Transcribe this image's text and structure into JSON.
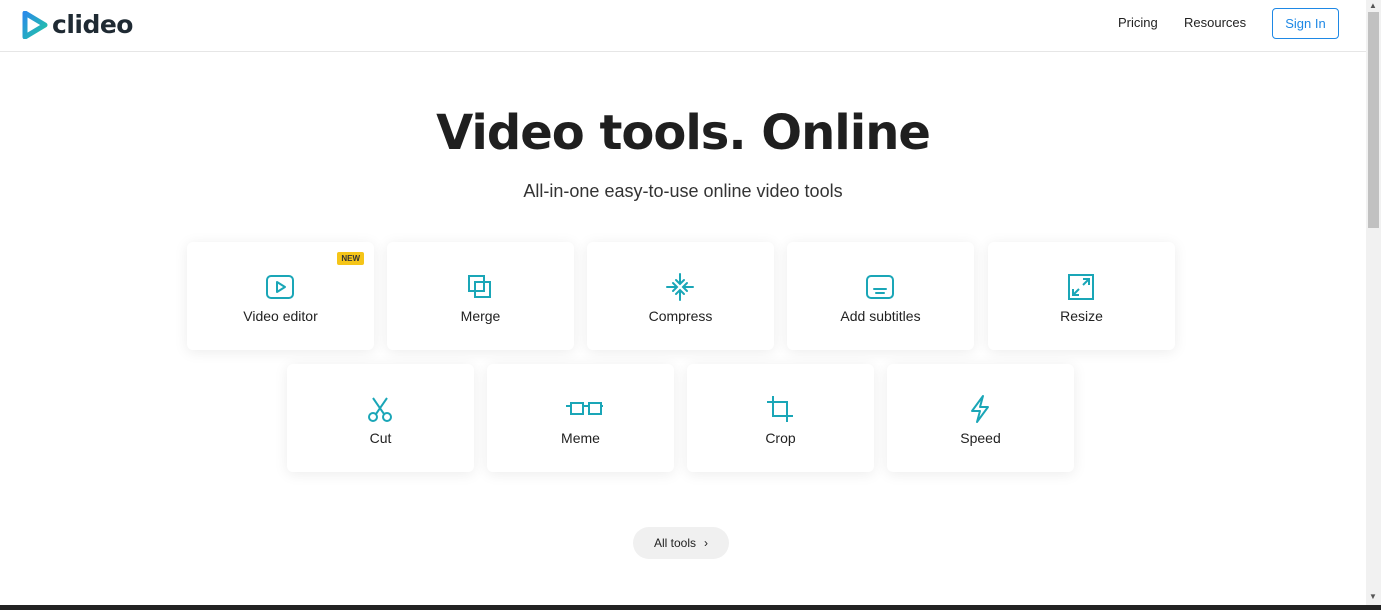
{
  "header": {
    "logo_text": "clideo",
    "nav": [
      {
        "label": "Pricing"
      },
      {
        "label": "Resources"
      }
    ],
    "signin_label": "Sign In"
  },
  "hero": {
    "title": "Video tools. Online",
    "subtitle": "All-in-one easy-to-use online video tools"
  },
  "tools": [
    {
      "label": "Video editor",
      "icon": "play-icon",
      "badge": "NEW"
    },
    {
      "label": "Merge",
      "icon": "merge-icon"
    },
    {
      "label": "Compress",
      "icon": "compress-icon"
    },
    {
      "label": "Add subtitles",
      "icon": "subtitles-icon"
    },
    {
      "label": "Resize",
      "icon": "resize-icon"
    },
    {
      "label": "Cut",
      "icon": "scissors-icon"
    },
    {
      "label": "Meme",
      "icon": "glasses-icon"
    },
    {
      "label": "Crop",
      "icon": "crop-icon"
    },
    {
      "label": "Speed",
      "icon": "lightning-icon"
    }
  ],
  "all_tools_label": "All tools",
  "colors": {
    "accent": "#1aa6b7",
    "button_blue": "#1e88e5",
    "badge": "#f5c518"
  }
}
